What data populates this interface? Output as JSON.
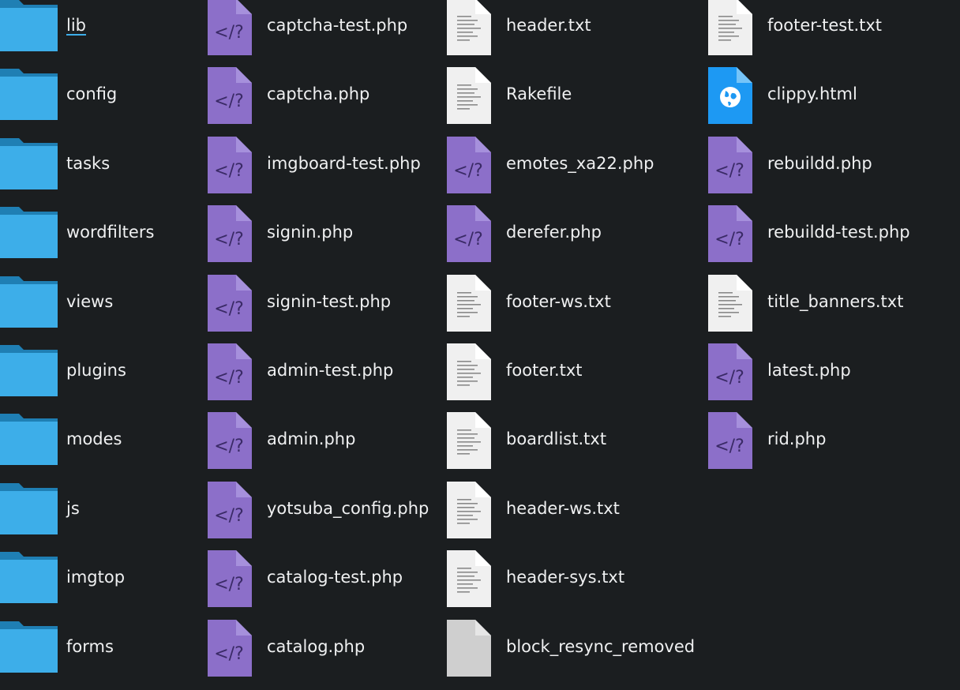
{
  "columns": [
    [
      {
        "name": "lib",
        "kind": "folder",
        "current": true
      },
      {
        "name": "config",
        "kind": "folder"
      },
      {
        "name": "tasks",
        "kind": "folder"
      },
      {
        "name": "wordfilters",
        "kind": "folder"
      },
      {
        "name": "views",
        "kind": "folder"
      },
      {
        "name": "plugins",
        "kind": "folder"
      },
      {
        "name": "modes",
        "kind": "folder"
      },
      {
        "name": "js",
        "kind": "folder"
      },
      {
        "name": "imgtop",
        "kind": "folder"
      },
      {
        "name": "forms",
        "kind": "folder"
      }
    ],
    [
      {
        "name": "captcha-test.php",
        "kind": "php"
      },
      {
        "name": "captcha.php",
        "kind": "php"
      },
      {
        "name": "imgboard-test.php",
        "kind": "php"
      },
      {
        "name": "signin.php",
        "kind": "php"
      },
      {
        "name": "signin-test.php",
        "kind": "php"
      },
      {
        "name": "admin-test.php",
        "kind": "php"
      },
      {
        "name": "admin.php",
        "kind": "php"
      },
      {
        "name": "yotsuba_config.php",
        "kind": "php"
      },
      {
        "name": "catalog-test.php",
        "kind": "php"
      },
      {
        "name": "catalog.php",
        "kind": "php"
      }
    ],
    [
      {
        "name": "header.txt",
        "kind": "text"
      },
      {
        "name": "Rakefile",
        "kind": "text"
      },
      {
        "name": "emotes_xa22.php",
        "kind": "php"
      },
      {
        "name": "derefer.php",
        "kind": "php"
      },
      {
        "name": "footer-ws.txt",
        "kind": "text"
      },
      {
        "name": "footer.txt",
        "kind": "text"
      },
      {
        "name": "boardlist.txt",
        "kind": "text"
      },
      {
        "name": "header-ws.txt",
        "kind": "text"
      },
      {
        "name": "header-sys.txt",
        "kind": "text"
      },
      {
        "name": "block_resync_removed",
        "kind": "blank"
      }
    ],
    [
      {
        "name": "footer-test.txt",
        "kind": "text"
      },
      {
        "name": "clippy.html",
        "kind": "html"
      },
      {
        "name": "rebuildd.php",
        "kind": "php"
      },
      {
        "name": "rebuildd-test.php",
        "kind": "php"
      },
      {
        "name": "title_banners.txt",
        "kind": "text"
      },
      {
        "name": "latest.php",
        "kind": "php"
      },
      {
        "name": "rid.php",
        "kind": "php"
      }
    ]
  ],
  "colors": {
    "background": "#1b1e20",
    "folder": "#3daee9",
    "php": "#8c6fc9",
    "text_file": "#f0f0f0",
    "html": "#1d99f3",
    "selection_underline": "#3daee9"
  },
  "icon_names": {
    "folder": "folder-icon",
    "php": "php-file-icon",
    "text": "text-file-icon",
    "html": "html-file-icon",
    "blank": "blank-file-icon"
  }
}
